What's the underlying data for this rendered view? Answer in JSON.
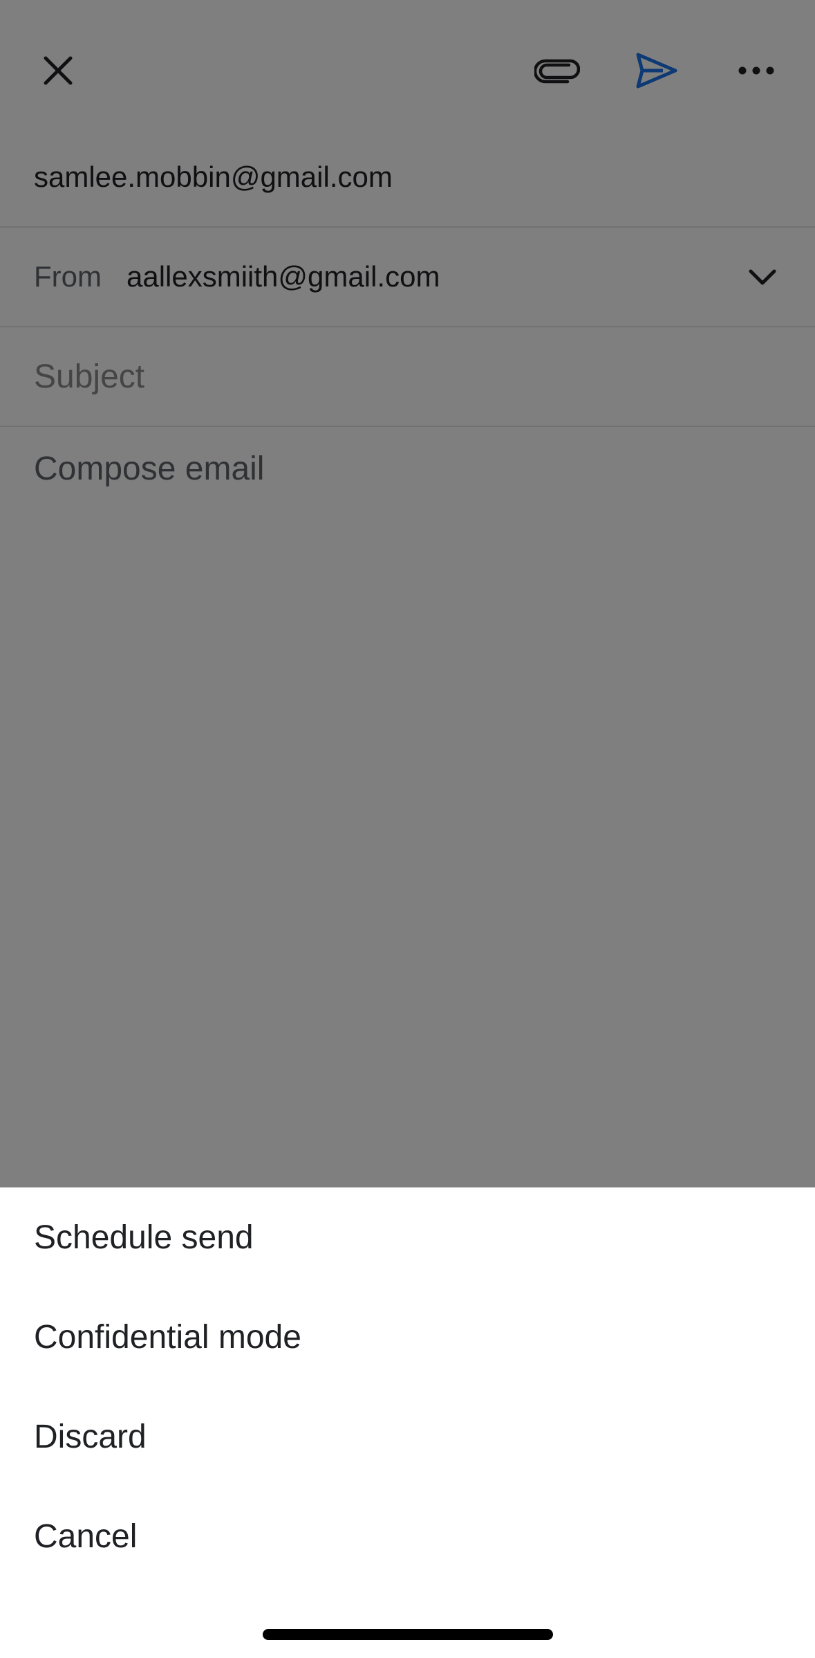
{
  "compose": {
    "to": "samlee.mobbin@gmail.com",
    "from_label": "From",
    "from_value": "aallexsmiith@gmail.com",
    "subject_placeholder": "Subject",
    "body_placeholder": "Compose email"
  },
  "icons": {
    "close": "close-icon",
    "attach": "paperclip-icon",
    "send": "send-icon",
    "more": "more-horizontal-icon",
    "from_dropdown": "chevron-down-icon"
  },
  "colors": {
    "send_accent": "#1a73e8",
    "scrim": "rgba(0,0,0,0.5)"
  },
  "sheet": {
    "items": [
      {
        "label": "Schedule send"
      },
      {
        "label": "Confidential mode"
      },
      {
        "label": "Discard"
      },
      {
        "label": "Cancel"
      }
    ]
  }
}
